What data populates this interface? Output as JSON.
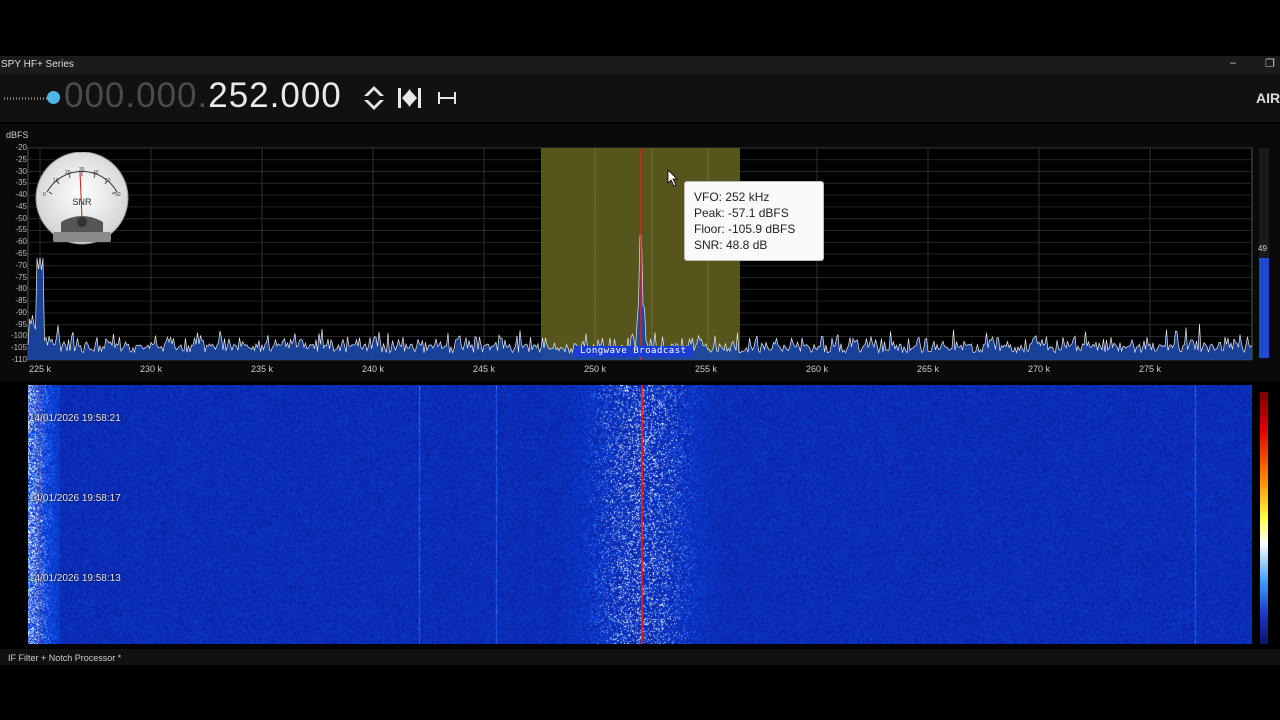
{
  "window": {
    "title": "SPY HF+ Series",
    "minimize_glyph": "–",
    "restore_glyph": "❐"
  },
  "toolbar": {
    "frequency_dim": "000.000.",
    "frequency_bright": "252.000",
    "brand": "AIR",
    "icons": [
      "volume-slider",
      "up-down-arrows-icon",
      "skip-to-start-icon",
      "span-width-icon"
    ]
  },
  "spectrum": {
    "unit": "dBFS",
    "y_labels": [
      "-20",
      "-25",
      "-30",
      "-35",
      "-40",
      "-45",
      "-50",
      "-55",
      "-60",
      "-65",
      "-70",
      "-75",
      "-80",
      "-85",
      "-90",
      "-95",
      "-100",
      "-105",
      "-110"
    ],
    "x_labels": [
      "225 k",
      "230 k",
      "235 k",
      "240 k",
      "245 k",
      "250 k",
      "255 k",
      "260 k",
      "265 k",
      "270 k",
      "275 k"
    ],
    "band_label": "Longwave Broadcast",
    "snr_meter_label": "SNR",
    "snr_bar_value": "49"
  },
  "tooltip": {
    "vfo": "VFO:  252 kHz",
    "peak": "Peak:  -57.1 dBFS",
    "floor": "Floor:  -105.9 dBFS",
    "snr": "SNR:  48.8 dB"
  },
  "waterfall": {
    "timestamps": [
      "14/01/2026 19:58:21",
      "14/01/2026 19:58:17",
      "14/01/2026 19:58:13"
    ]
  },
  "statusbar": {
    "text": "IF Filter + Notch Processor *"
  },
  "colors": {
    "accent": "#4fb6e6",
    "band_highlight": "#5a5a1e",
    "vfo_line": "#e02020",
    "waterfall_bg": "#0d1fa8",
    "band_label_bg": "#1c3cd6"
  }
}
